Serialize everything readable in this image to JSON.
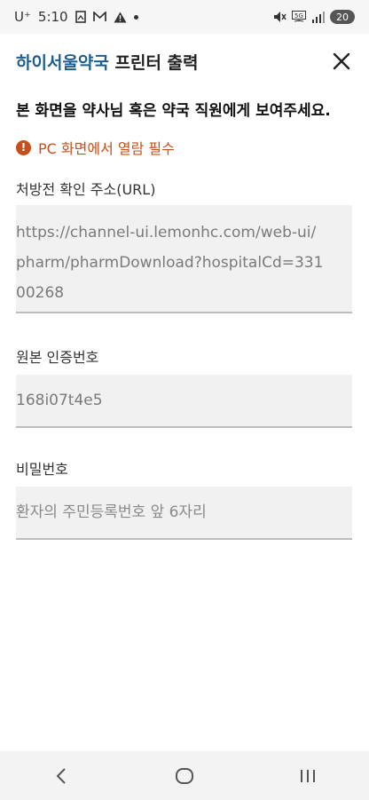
{
  "status_bar": {
    "carrier": "U⁺",
    "time": "5:10",
    "battery": "20",
    "icons": [
      "gallery-icon",
      "mail-icon",
      "alert-icon",
      "dot-icon",
      "mute-icon",
      "5g-icon",
      "signal-icon",
      "battery-icon"
    ]
  },
  "header": {
    "title_brand": "하이서울약국",
    "title_rest": " 프린터 출력",
    "close_icon": "close-icon"
  },
  "notice": "본 화면을 약사님 혹은 약국 직원에게 보여주세요.",
  "warning": {
    "icon": "exclamation-circle-icon",
    "text": "PC 화면에서 열람 필수",
    "color": "#c5501b"
  },
  "fields": {
    "url": {
      "label": "처방전 확인 주소(URL)",
      "line1": "https://channel-ui.lemonhc.com/web-ui/",
      "line2": "pharm/pharmDownload?hospitalCd=331",
      "line3": "00268"
    },
    "code": {
      "label": "원본 인증번호",
      "value": "168i07t4e5"
    },
    "password": {
      "label": "비밀번호",
      "placeholder": "환자의 주민등록번호 앞 6자리"
    }
  },
  "nav_bar": {
    "back": "back-icon",
    "home": "home-icon",
    "recents": "recents-icon"
  },
  "colors": {
    "brand": "#1f5e8c",
    "warning": "#c5501b",
    "field_bg": "#f1f1f1"
  }
}
